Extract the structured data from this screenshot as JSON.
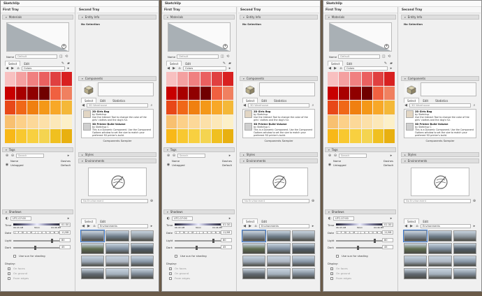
{
  "app_title": "SketchUp",
  "first_tray": "First Tray",
  "second_tray": "Second Tray",
  "materials": {
    "header": "Materials",
    "name_label": "Name",
    "name_placeholder": "Default",
    "tab_select": "Select",
    "tab_edit": "Edit",
    "library": "Colors",
    "swatches": [
      "#f8c0c0",
      "#f4a0a0",
      "#f08080",
      "#ea6060",
      "#e04040",
      "#d82020",
      "#c80000",
      "#a80000",
      "#900000",
      "#700000",
      "#f06040",
      "#f08060",
      "#e84818",
      "#f06818",
      "#f08010",
      "#f49818",
      "#f8a828",
      "#f4b838",
      "#f8c070",
      "#fcd088",
      "#fcd898",
      "#fce0a8",
      "#fce8b8",
      "#fcf0c8",
      "#f8b818",
      "#f8c830",
      "#f8d040",
      "#f4d450",
      "#f0c020",
      "#e8b010"
    ]
  },
  "entity_info": {
    "header": "Entity Info",
    "status": "No Selection"
  },
  "components": {
    "header": "Components",
    "search_placeholder": "3D Warehouse",
    "tab_select": "Select",
    "tab_edit": "Edit",
    "tab_statistics": "Statistics",
    "items": [
      {
        "title": "2D Girls Bag",
        "author": "by Sketchup",
        "desc": "Use the Interact Tool to change the color of the girls' clothes and the dog's fur."
      },
      {
        "title": "3D Printer Build Volume",
        "author": "by Sketchup C",
        "desc": "This is a Dynamic Component. Use the Component Options window to set the size to match your preferred 3D printer's build."
      }
    ],
    "sampler": "Components Sampler"
  },
  "tags": {
    "header": "Tags",
    "search_placeholder": "Search",
    "col_name": "Name",
    "col_dashes": "Dashes",
    "row_name": "Untagged",
    "row_dashes": "Default"
  },
  "styles": {
    "header": "Styles"
  },
  "environments": {
    "header": "Environments",
    "name_placeholder": "No Environment",
    "tab_select": "Select",
    "tab_edit": "Edit",
    "library": "Environments",
    "thumbs": [
      "#7a8590",
      "#6d7b88",
      "#8a949c",
      "#5c6a4e",
      "#7b8a9a",
      "#4f5b66",
      "#9aa6b4",
      "#b0b8c4",
      "#8896a6",
      "#606870",
      "#a4b0bc",
      "#7c8894"
    ]
  },
  "shadows": {
    "header": "Shadows",
    "timezone": "UTC-07:00",
    "time_label": "Time",
    "time_start": "06:43 AM",
    "time_noon": "Noon",
    "time_end": "04:46 PM",
    "time_value": "01:30 pm",
    "date_label": "Date",
    "months": [
      "J",
      "F",
      "M",
      "A",
      "M",
      "J",
      "J",
      "A",
      "S",
      "O",
      "N",
      "D"
    ],
    "date_value": "11/08",
    "light_label": "Light",
    "light_value": "80",
    "dark_label": "Dark",
    "dark_value": "45",
    "use_sun": "Use sun for shading",
    "display_label": "Display:",
    "on_faces": "On faces",
    "on_ground": "On ground",
    "from_edges": "From edges"
  },
  "colors": {
    "header_bg": "#dedede",
    "panel_bg": "#f0f0f0",
    "backdrop": "#6a5a48"
  }
}
